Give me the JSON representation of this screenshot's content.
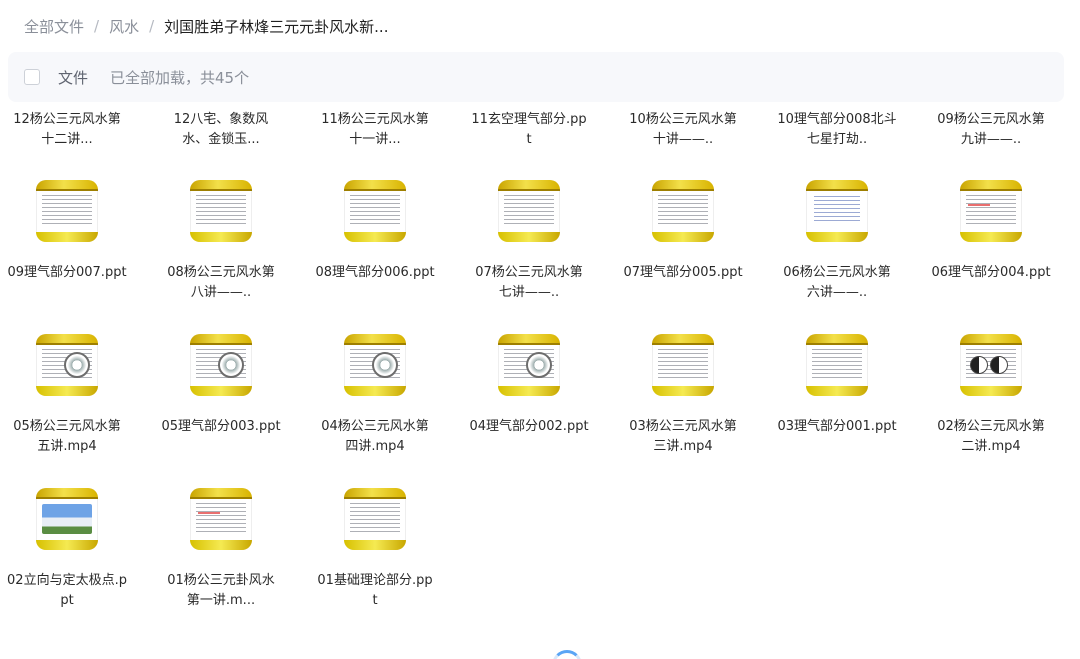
{
  "breadcrumb": {
    "items": [
      "全部文件",
      "风水"
    ],
    "current": "刘国胜弟子林烽三元元卦风水新..."
  },
  "header": {
    "column_label": "文件",
    "status": "已全部加载，共45个"
  },
  "top_row_names": [
    "12杨公三元风水第十二讲...",
    "12八宅、象数风水、金锁玉...",
    "11杨公三元风水第十一讲...",
    "11玄空理气部分.ppt",
    "10杨公三元风水第十讲——..",
    "10理气部分008北斗七星打劫..",
    "09杨公三元风水第九讲——.."
  ],
  "files": [
    {
      "name": "09理气部分007.ppt",
      "thumb": "text"
    },
    {
      "name": "08杨公三元风水第八讲——..",
      "thumb": "text"
    },
    {
      "name": "08理气部分006.ppt",
      "thumb": "text"
    },
    {
      "name": "07杨公三元风水第七讲——..",
      "thumb": "text"
    },
    {
      "name": "07理气部分005.ppt",
      "thumb": "text"
    },
    {
      "name": "06杨公三元风水第六讲——..",
      "thumb": "blue"
    },
    {
      "name": "06理气部分004.ppt",
      "thumb": "text-red"
    },
    {
      "name": "05杨公三元风水第五讲.mp4",
      "thumb": "compass"
    },
    {
      "name": "05理气部分003.ppt",
      "thumb": "compass"
    },
    {
      "name": "04杨公三元风水第四讲.mp4",
      "thumb": "compass"
    },
    {
      "name": "04理气部分002.ppt",
      "thumb": "compass"
    },
    {
      "name": "03杨公三元风水第三讲.mp4",
      "thumb": "text"
    },
    {
      "name": "03理气部分001.ppt",
      "thumb": "text"
    },
    {
      "name": "02杨公三元风水第二讲.mp4",
      "thumb": "taiji"
    },
    {
      "name": "02立向与定太极点.ppt",
      "thumb": "house"
    },
    {
      "name": "01杨公三元卦风水第一讲.m...",
      "thumb": "text-red"
    },
    {
      "name": "01基础理论部分.ppt",
      "thumb": "text"
    }
  ],
  "icons": {
    "thumbnail": "ppt-slide-thumbnail",
    "loader": "loading-spinner-icon"
  },
  "colors": {
    "accent": "#5aa5f5",
    "slide_yellow": "#f3e04a"
  }
}
